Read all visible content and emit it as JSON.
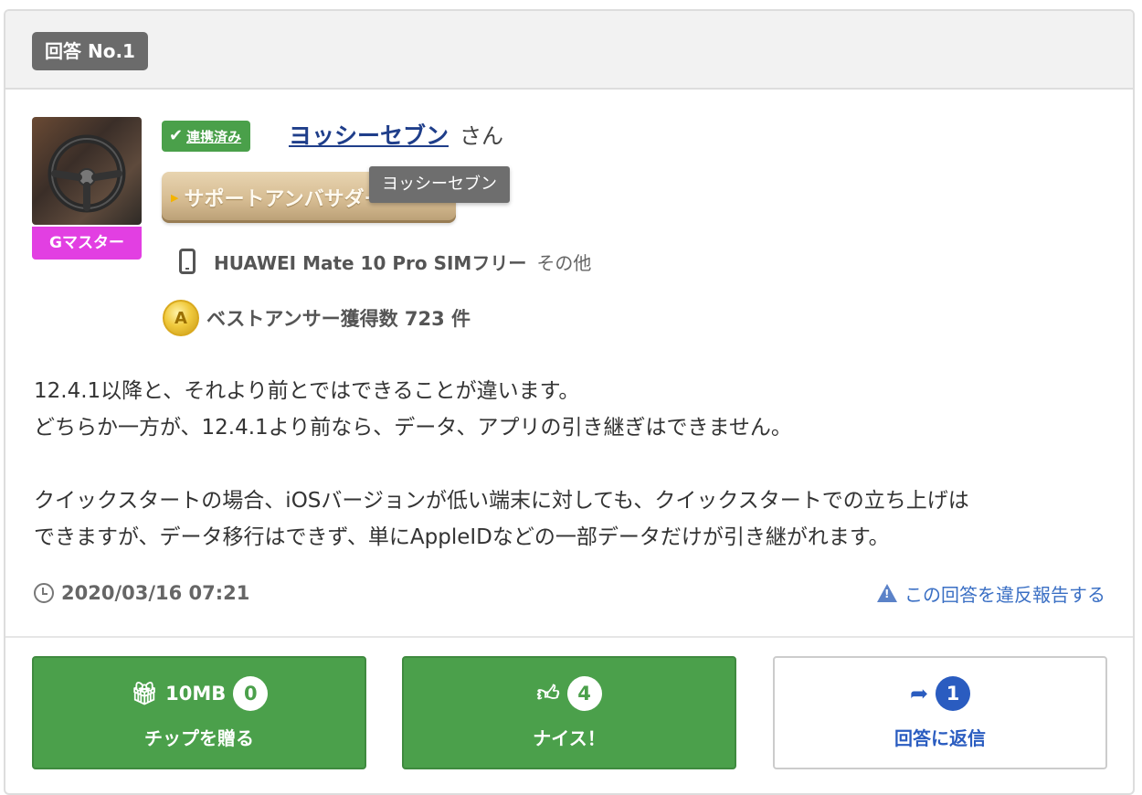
{
  "header": {
    "answer_label": "回答 No.1"
  },
  "user": {
    "rank": "Gマスター",
    "linked_label": "連携済み",
    "name": "ヨッシーセブン",
    "honorific": "さん",
    "ambassador_label": "サポートアンバサダー",
    "tooltip": "ヨッシーセブン",
    "device_name": "HUAWEI Mate 10 Pro SIMフリー",
    "device_carrier": "その他",
    "best_answer": "ベストアンサー獲得数 723 件",
    "medal_letter": "A"
  },
  "answer": {
    "lines_1": [
      "12.4.1以降と、それより前とではできることが違います。",
      "どちらか一方が、12.4.1より前なら、データ、アプリの引き継ぎはできません。"
    ],
    "lines_2": [
      "クイックスタートの場合、iOSバージョンが低い端末に対しても、クイックスタートでの立ち上げは",
      "できますが、データ移行はできず、単にAppleIDなどの一部データだけが引き継がれます。"
    ],
    "timestamp": "2020/03/16 07:21",
    "report_link": "この回答を違反報告する"
  },
  "actions": {
    "tip": {
      "amount": "10MB",
      "count": "0",
      "label": "チップを贈る"
    },
    "nice": {
      "count": "4",
      "label": "ナイス！"
    },
    "reply": {
      "count": "1",
      "label": "回答に返信"
    }
  },
  "colors": {
    "green": "#4ba04b",
    "rank_magenta": "#e23fe2",
    "link_blue": "#1f3e8a",
    "accent_blue": "#2a5cc0"
  }
}
